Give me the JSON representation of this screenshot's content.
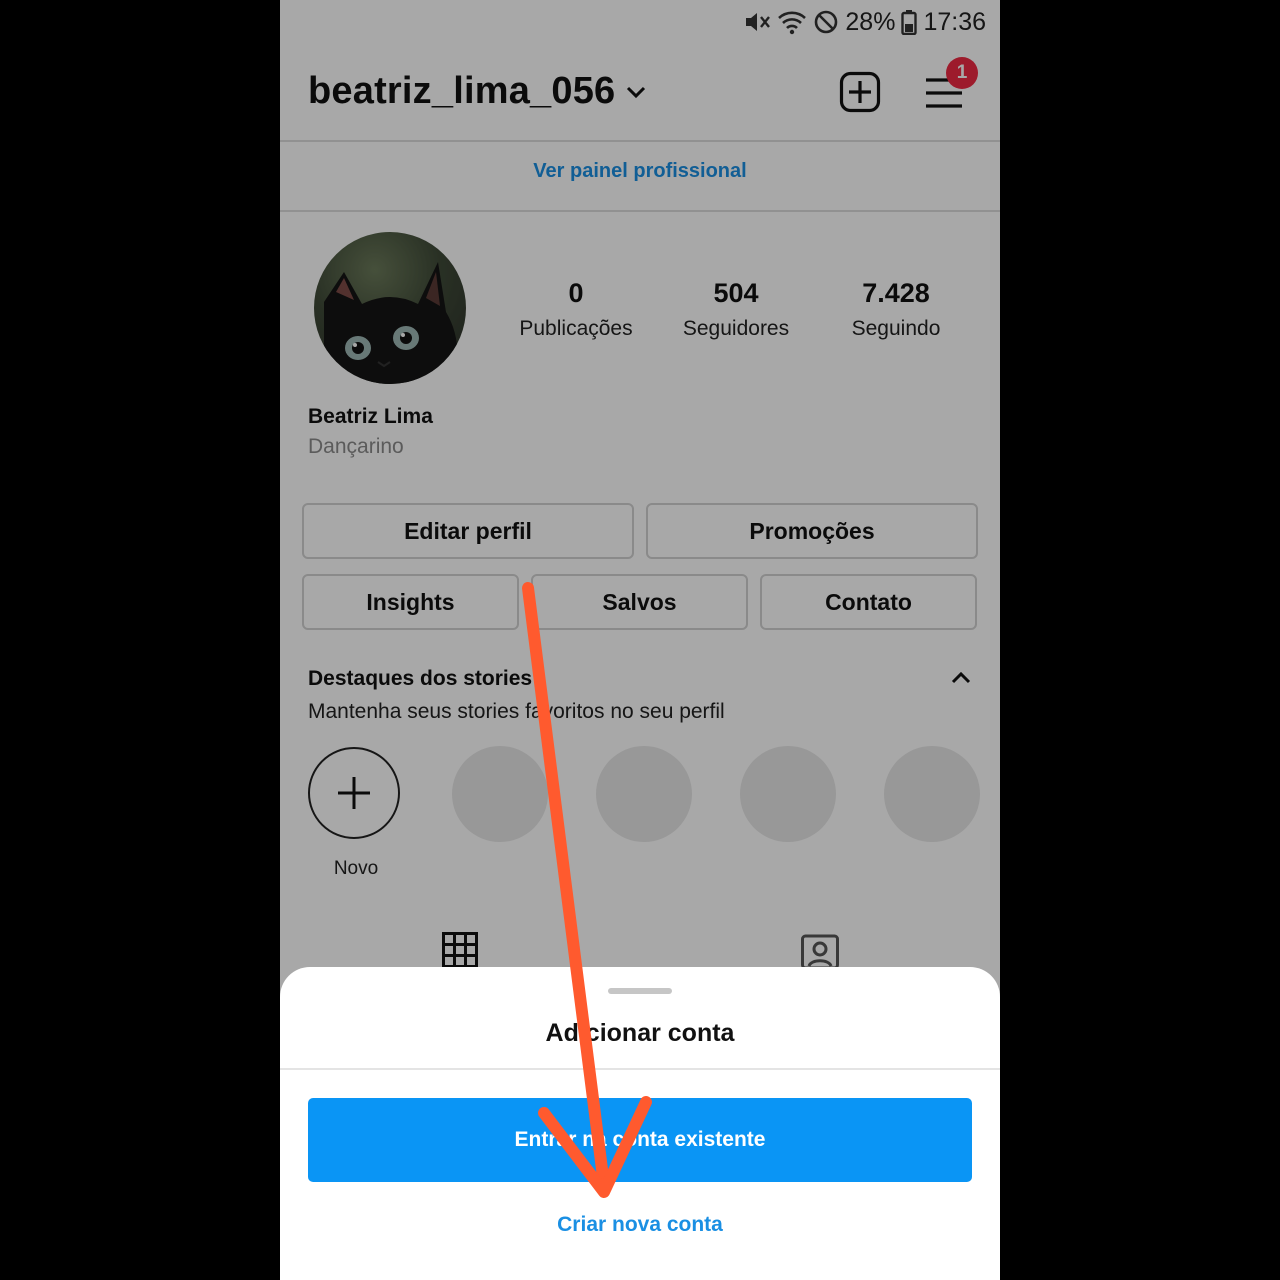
{
  "status_bar": {
    "battery": "28%",
    "time": "17:36"
  },
  "header": {
    "username": "beatriz_lima_056",
    "notification_count": "1"
  },
  "pro_dashboard_link": "Ver painel profissional",
  "profile": {
    "stats": [
      {
        "value": "0",
        "label": "Publicações"
      },
      {
        "value": "504",
        "label": "Seguidores"
      },
      {
        "value": "7.428",
        "label": "Seguindo"
      }
    ],
    "name": "Beatriz Lima",
    "category": "Dançarino"
  },
  "buttons": {
    "edit_profile": "Editar perfil",
    "promotions": "Promoções",
    "insights": "Insights",
    "saved": "Salvos",
    "contact": "Contato"
  },
  "highlights": {
    "title": "Destaques dos stories",
    "subtitle": "Mantenha seus stories favoritos no seu perfil",
    "new_label": "Novo"
  },
  "sheet": {
    "title": "Adicionar conta",
    "login_button": "Entrar na conta existente",
    "create_link": "Criar nova conta"
  },
  "colors": {
    "accent_blue": "#0a95f5",
    "link_blue": "#1a8fe3",
    "badge_red": "#ef2a43",
    "annotation_arrow": "#ff5a2e"
  }
}
